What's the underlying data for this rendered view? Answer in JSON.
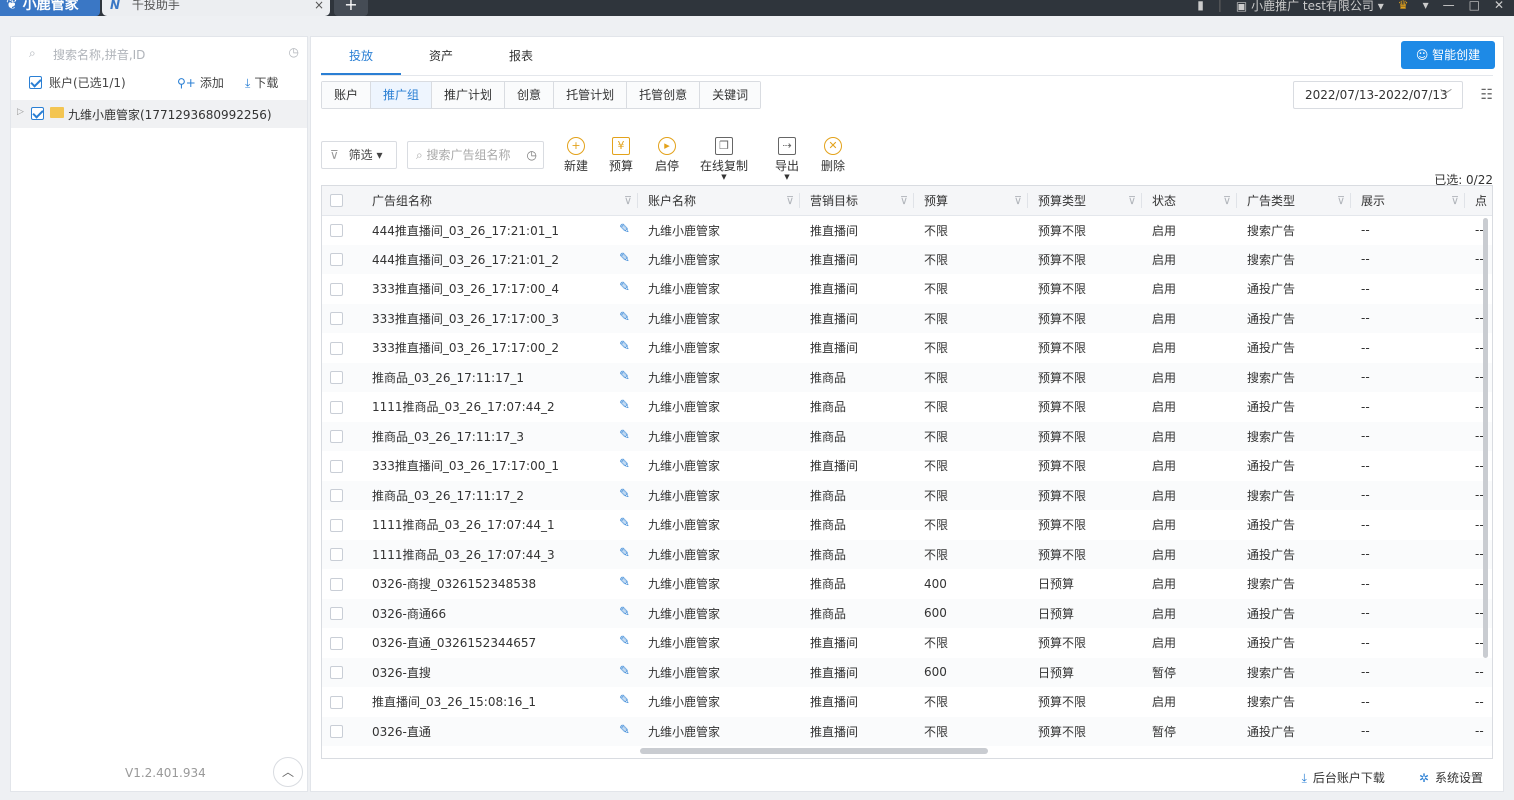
{
  "titlebar": {
    "brand": "小鹿管家",
    "app_tab": "千投助手",
    "tab_close": "×",
    "new_tab": "+",
    "user": "小鹿推广 test有限公司",
    "user_dropdown": "▾"
  },
  "sidebar": {
    "search_placeholder": "搜索名称,拼音,ID",
    "account_label": "账户(已选1/1)",
    "add_label": "添加",
    "download_label": "下载",
    "tree_item": "九维小鹿管家(1771293680992256)",
    "version": "V1.2.401.934"
  },
  "top_tabs": [
    {
      "label": "投放",
      "active": true
    },
    {
      "label": "资产",
      "active": false
    },
    {
      "label": "报表",
      "active": false
    }
  ],
  "ai_button": "智能创建",
  "sub_tabs": [
    {
      "label": "账户",
      "active": false
    },
    {
      "label": "推广组",
      "active": true
    },
    {
      "label": "推广计划",
      "active": false
    },
    {
      "label": "创意",
      "active": false
    },
    {
      "label": "托管计划",
      "active": false
    },
    {
      "label": "托管创意",
      "active": false
    },
    {
      "label": "关键词",
      "active": false
    }
  ],
  "date_range": "2022/07/13-2022/07/13",
  "toolbar": {
    "filter_label": "筛选",
    "search_placeholder": "搜索广告组名称",
    "buttons": [
      {
        "label": "新建",
        "icon": "plus-circle-icon"
      },
      {
        "label": "预算",
        "icon": "yen-icon"
      },
      {
        "label": "启停",
        "icon": "play-pause-icon"
      },
      {
        "label": "在线复制",
        "icon": "copy-icon"
      },
      {
        "label": "导出",
        "icon": "export-icon"
      },
      {
        "label": "删除",
        "icon": "delete-icon"
      }
    ],
    "selected": "已选: 0/22"
  },
  "table": {
    "headers": [
      "广告组名称",
      "账户名称",
      "营销目标",
      "预算",
      "预算类型",
      "状态",
      "广告类型",
      "展示",
      "点"
    ],
    "rows": [
      [
        "444推直播间_03_26_17:21:01_1",
        "九维小鹿管家",
        "推直播间",
        "不限",
        "预算不限",
        "启用",
        "搜索广告",
        "--",
        "--"
      ],
      [
        "444推直播间_03_26_17:21:01_2",
        "九维小鹿管家",
        "推直播间",
        "不限",
        "预算不限",
        "启用",
        "搜索广告",
        "--",
        "--"
      ],
      [
        "333推直播间_03_26_17:17:00_4",
        "九维小鹿管家",
        "推直播间",
        "不限",
        "预算不限",
        "启用",
        "通投广告",
        "--",
        "--"
      ],
      [
        "333推直播间_03_26_17:17:00_3",
        "九维小鹿管家",
        "推直播间",
        "不限",
        "预算不限",
        "启用",
        "通投广告",
        "--",
        "--"
      ],
      [
        "333推直播间_03_26_17:17:00_2",
        "九维小鹿管家",
        "推直播间",
        "不限",
        "预算不限",
        "启用",
        "通投广告",
        "--",
        "--"
      ],
      [
        "推商品_03_26_17:11:17_1",
        "九维小鹿管家",
        "推商品",
        "不限",
        "预算不限",
        "启用",
        "搜索广告",
        "--",
        "--"
      ],
      [
        "1111推商品_03_26_17:07:44_2",
        "九维小鹿管家",
        "推商品",
        "不限",
        "预算不限",
        "启用",
        "通投广告",
        "--",
        "--"
      ],
      [
        "推商品_03_26_17:11:17_3",
        "九维小鹿管家",
        "推商品",
        "不限",
        "预算不限",
        "启用",
        "搜索广告",
        "--",
        "--"
      ],
      [
        "333推直播间_03_26_17:17:00_1",
        "九维小鹿管家",
        "推直播间",
        "不限",
        "预算不限",
        "启用",
        "通投广告",
        "--",
        "--"
      ],
      [
        "推商品_03_26_17:11:17_2",
        "九维小鹿管家",
        "推商品",
        "不限",
        "预算不限",
        "启用",
        "搜索广告",
        "--",
        "--"
      ],
      [
        "1111推商品_03_26_17:07:44_1",
        "九维小鹿管家",
        "推商品",
        "不限",
        "预算不限",
        "启用",
        "通投广告",
        "--",
        "--"
      ],
      [
        "1111推商品_03_26_17:07:44_3",
        "九维小鹿管家",
        "推商品",
        "不限",
        "预算不限",
        "启用",
        "通投广告",
        "--",
        "--"
      ],
      [
        "0326-商搜_0326152348538",
        "九维小鹿管家",
        "推商品",
        "400",
        "日预算",
        "启用",
        "搜索广告",
        "--",
        "--"
      ],
      [
        "0326-商通66",
        "九维小鹿管家",
        "推商品",
        "600",
        "日预算",
        "启用",
        "通投广告",
        "--",
        "--"
      ],
      [
        "0326-直通_0326152344657",
        "九维小鹿管家",
        "推直播间",
        "不限",
        "预算不限",
        "启用",
        "通投广告",
        "--",
        "--"
      ],
      [
        "0326-直搜",
        "九维小鹿管家",
        "推直播间",
        "600",
        "日预算",
        "暂停",
        "搜索广告",
        "--",
        "--"
      ],
      [
        "推直播间_03_26_15:08:16_1",
        "九维小鹿管家",
        "推直播间",
        "不限",
        "预算不限",
        "启用",
        "搜索广告",
        "--",
        "--"
      ],
      [
        "0326-直通",
        "九维小鹿管家",
        "推直播间",
        "不限",
        "预算不限",
        "暂停",
        "通投广告",
        "--",
        "--"
      ]
    ]
  },
  "footer": {
    "backend_download": "后台账户下载",
    "settings": "系统设置"
  },
  "colors": {
    "accent": "#2a7fd4",
    "ai_button": "#1e8ae6",
    "titlebar": "#2f353c"
  }
}
